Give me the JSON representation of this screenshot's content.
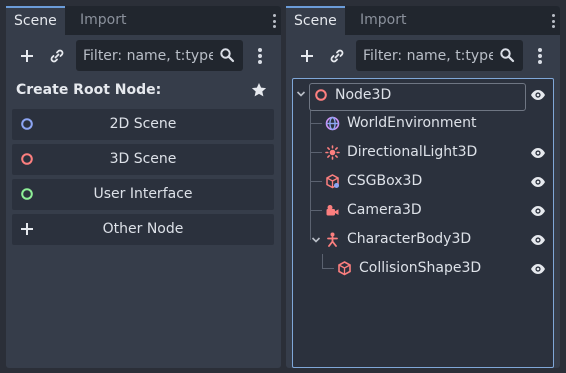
{
  "left_panel": {
    "tabs": [
      {
        "label": "Scene",
        "active": true
      },
      {
        "label": "Import",
        "active": false
      }
    ],
    "filter": {
      "placeholder": "Filter: name, t:type, "
    },
    "create_root_title": "Create Root Node:",
    "root_options": [
      {
        "label": "2D Scene",
        "icon": "node2d-circle-icon",
        "color": "#8da5f3"
      },
      {
        "label": "3D Scene",
        "icon": "node3d-circle-icon",
        "color": "#fc7f7f"
      },
      {
        "label": "User Interface",
        "icon": "control-circle-icon",
        "color": "#8eef97"
      },
      {
        "label": "Other Node",
        "icon": "plus-icon",
        "color": "#e0e0e0"
      }
    ]
  },
  "right_panel": {
    "tabs": [
      {
        "label": "Scene",
        "active": true
      },
      {
        "label": "Import",
        "active": false
      }
    ],
    "filter": {
      "placeholder": "Filter: name, t:type, "
    },
    "tree": [
      {
        "name": "Node3D",
        "icon": "node3d-icon",
        "expanded": true,
        "visible_toggle": true,
        "selected": true
      },
      {
        "name": "WorldEnvironment",
        "icon": "world-environment-icon",
        "visible_toggle": false
      },
      {
        "name": "DirectionalLight3D",
        "icon": "directional-light-icon",
        "visible_toggle": true
      },
      {
        "name": "CSGBox3D",
        "icon": "csg-box-icon",
        "visible_toggle": true
      },
      {
        "name": "Camera3D",
        "icon": "camera-icon",
        "visible_toggle": true
      },
      {
        "name": "CharacterBody3D",
        "icon": "character-body-icon",
        "expanded": true,
        "visible_toggle": true
      },
      {
        "name": "CollisionShape3D",
        "icon": "collision-shape-icon",
        "visible_toggle": true
      }
    ]
  },
  "colors": {
    "accent": "#6b9cd9",
    "node3d": "#fc7f7f",
    "node2d": "#8da5f3",
    "control": "#8eef97",
    "world": "#8da5f3"
  }
}
